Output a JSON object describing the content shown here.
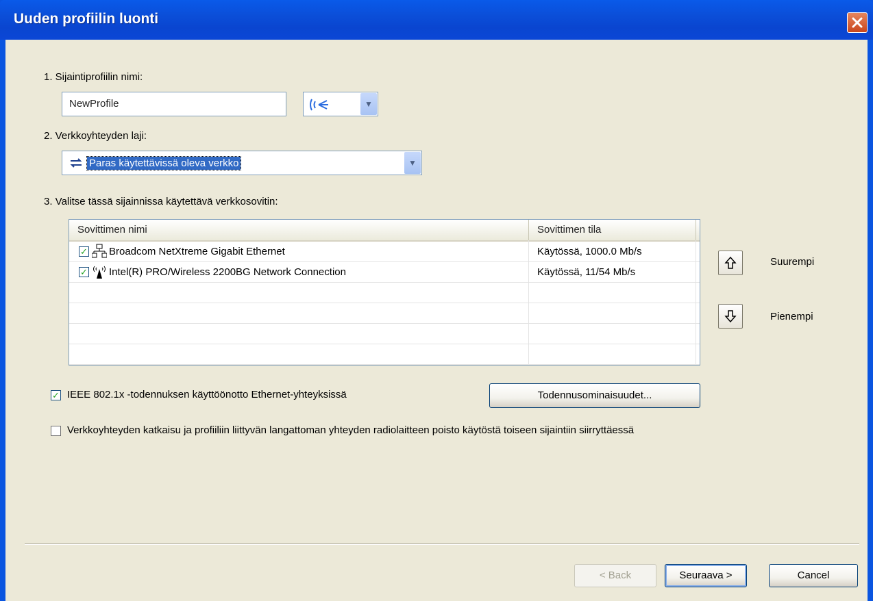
{
  "window": {
    "title": "Uuden profiilin luonti"
  },
  "step1": {
    "label": "1. Sijaintiprofiilin nimi:",
    "name_value": "NewProfile"
  },
  "step2": {
    "label": "2. Verkkoyhteyden laji:",
    "selected": "Paras käytettävissä oleva verkko"
  },
  "step3": {
    "label": "3. Valitse tässä sijainnissa käytettävä verkkosovitin:"
  },
  "adapters": {
    "col_name": "Sovittimen nimi",
    "col_state": "Sovittimen tila",
    "rows": [
      {
        "name": "Broadcom NetXtreme Gigabit Ethernet",
        "state": "Käytössä, 1000.0 Mb/s",
        "checked": true,
        "icon": "wired-network-icon"
      },
      {
        "name": "Intel(R) PRO/Wireless 2200BG Network Connection",
        "state": "Käytössä, 11/54 Mb/s",
        "checked": true,
        "icon": "wireless-antenna-icon"
      }
    ]
  },
  "priority": {
    "up_label": "Suurempi",
    "down_label": "Pienempi"
  },
  "options": {
    "ieee_label": "IEEE 802.1x -todennuksen käyttöönotto Ethernet-yhteyksissä",
    "ieee_checked": true,
    "auth_button": "Todennusominaisuudet...",
    "disconnect_label": "Verkkoyhteyden katkaisu ja profiiliin liittyvän langattoman yhteyden radiolaitteen poisto käytöstä toiseen sijaintiin siirryttäessä",
    "disconnect_checked": false
  },
  "footer": {
    "back": "< Back",
    "next": "Seuraava >",
    "cancel": "Cancel"
  }
}
